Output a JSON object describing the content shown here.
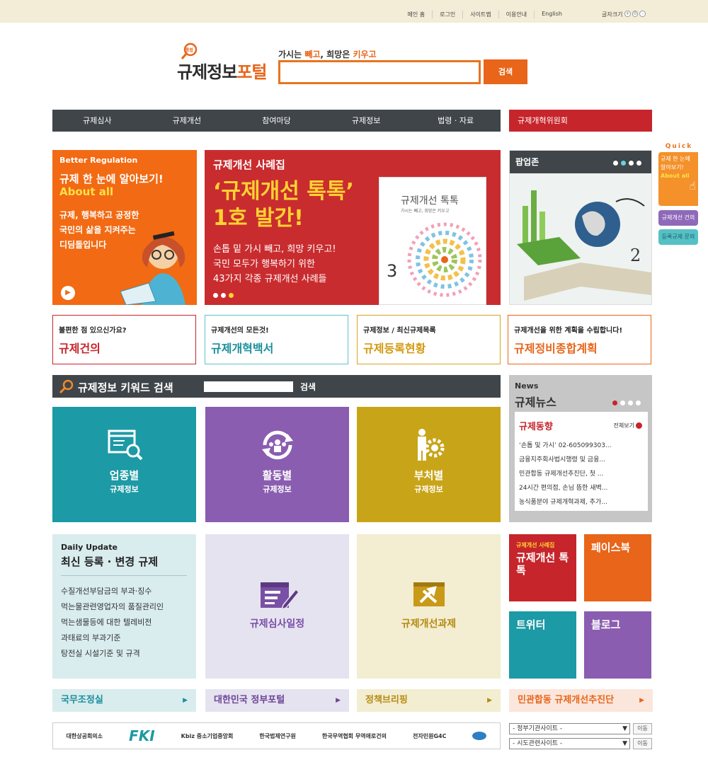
{
  "util": {
    "items": [
      "메인 홈",
      "로그인",
      "사이트맵",
      "이용안내",
      "English"
    ],
    "font_size": "글자크기"
  },
  "header": {
    "logo_small": "통합",
    "logo_main": "규제정보",
    "logo_accent": "포털",
    "slogan_a": "가시는 ",
    "slogan_b": "빼고",
    "slogan_c": ", 희망은 ",
    "slogan_d": "키우고",
    "search_btn": "검색"
  },
  "nav": {
    "items": [
      "규제심사",
      "규제개선",
      "참여마당",
      "규제정보",
      "법령 · 자료"
    ],
    "special": "규제개혁위원회"
  },
  "banner1": {
    "t1": "Better Regulation",
    "t2": "규제 한 눈에 알아보기!",
    "t3": "About all",
    "t4": "규제, 행복하고 공정한 국민의 삶을 지켜주는 디딤돌입니다"
  },
  "banner2": {
    "h": "규제개선 사례집",
    "big1": "‘규제개선 톡톡’",
    "big2": "1호 발간!",
    "d1": "손톱 밑 가시 빼고, 희망 키우고!",
    "d2": "국민 모두가 행복하기 위한",
    "d3": "43가지 각종 규제개선 사례들",
    "book_title": "규제개선 톡톡",
    "book_sub": "가시는 빼고, 희망은 키우고",
    "book_num": "3"
  },
  "popup": {
    "title": "팝업존"
  },
  "quick": {
    "label": "Quick",
    "b1": "규제 한 눈에 알아보기!",
    "b1b": "About all",
    "b2": "규제개선 건의",
    "b3": "등록규제 문의"
  },
  "cards": [
    {
      "s": "불편한 점 있으신가요?",
      "l": "규제건의",
      "color": "#c6252b",
      "border": "#c6252b"
    },
    {
      "s": "규제개선의 모든것!",
      "l": "규제개혁백서",
      "color": "#1a8f9b",
      "border": "#5fc2ca"
    },
    {
      "s": "규제정보 / 최신규제목록",
      "l": "규제등록현황",
      "color": "#d39a10",
      "border": "#d9a321"
    },
    {
      "s": "규제개선을 위한 계획을 수립합니다!",
      "l": "규제정비종합계획",
      "color": "#e8651a",
      "border": "#e8651a"
    }
  ],
  "keyword": {
    "title": "규제정보 키워드 검색",
    "btn": "검색"
  },
  "news": {
    "s": "News",
    "t": "규제뉴스",
    "h": "규제동향",
    "more": "전체보기",
    "items": [
      "‘손톱 및 가시’ 02-605099303...",
      "금융지주회사법시행령 및 금융...",
      "민관합동 규제개선추진단, 첫 ...",
      "24시간 편의점, 손님 뜸한 새벽...",
      "농식품분야 규제개혁과제, 추가..."
    ]
  },
  "tiles": [
    {
      "a": "업종별",
      "b": "규제정보",
      "bg": "#1c9aa5"
    },
    {
      "a": "활동별",
      "b": "규제정보",
      "bg": "#8a5db0"
    },
    {
      "a": "부처별",
      "b": "규제정보",
      "bg": "#c8a418"
    }
  ],
  "daily": {
    "s": "Daily Update",
    "t": "최신 등록 · 변경 규제",
    "items": [
      "수질개선부담금의 부과·징수",
      "먹는물관련영업자의 품질관리인",
      "먹는샘물등에 대한 텔레비전",
      "과태료의 부과기준",
      "탕전실 시설기준 및 규격"
    ]
  },
  "light_tiles": [
    {
      "l": "규제심사일정",
      "bg": "#e6e3f0",
      "color": "#7a4fa6"
    },
    {
      "l": "규제개선과제",
      "bg": "#f3edd1",
      "color": "#b58a10"
    }
  ],
  "squares": [
    {
      "s": "규제개선 사례집",
      "l": "규제개선 톡톡",
      "bg": "#c6252b"
    },
    {
      "l": "페이스북",
      "bg": "#e8651a"
    },
    {
      "l": "트위터",
      "bg": "#1c9aa5"
    },
    {
      "l": "블로그",
      "bg": "#8a5db0"
    }
  ],
  "bars": [
    {
      "l": "국무조정실",
      "bg": "#d9ecee",
      "color": "#1a8f9b"
    },
    {
      "l": "대한민국 정부포털",
      "bg": "#e6e3f0",
      "color": "#6b4696"
    },
    {
      "l": "정책브리핑",
      "bg": "#f3edd1",
      "color": "#b58a10"
    },
    {
      "l": "민관합동 규제개선추진단",
      "bg": "#fbe6dc",
      "color": "#e8651a"
    }
  ],
  "partners": [
    "대한상공회의소",
    "FKI",
    "Kbiz 중소기업중앙회",
    "한국법제연구원",
    "한국무역협회 무역애로건의",
    "전자민원G4C"
  ],
  "selects": {
    "s1": "- 정부기관사이트 -",
    "s2": "- 시도관련사이트 -",
    "go": "이동"
  }
}
